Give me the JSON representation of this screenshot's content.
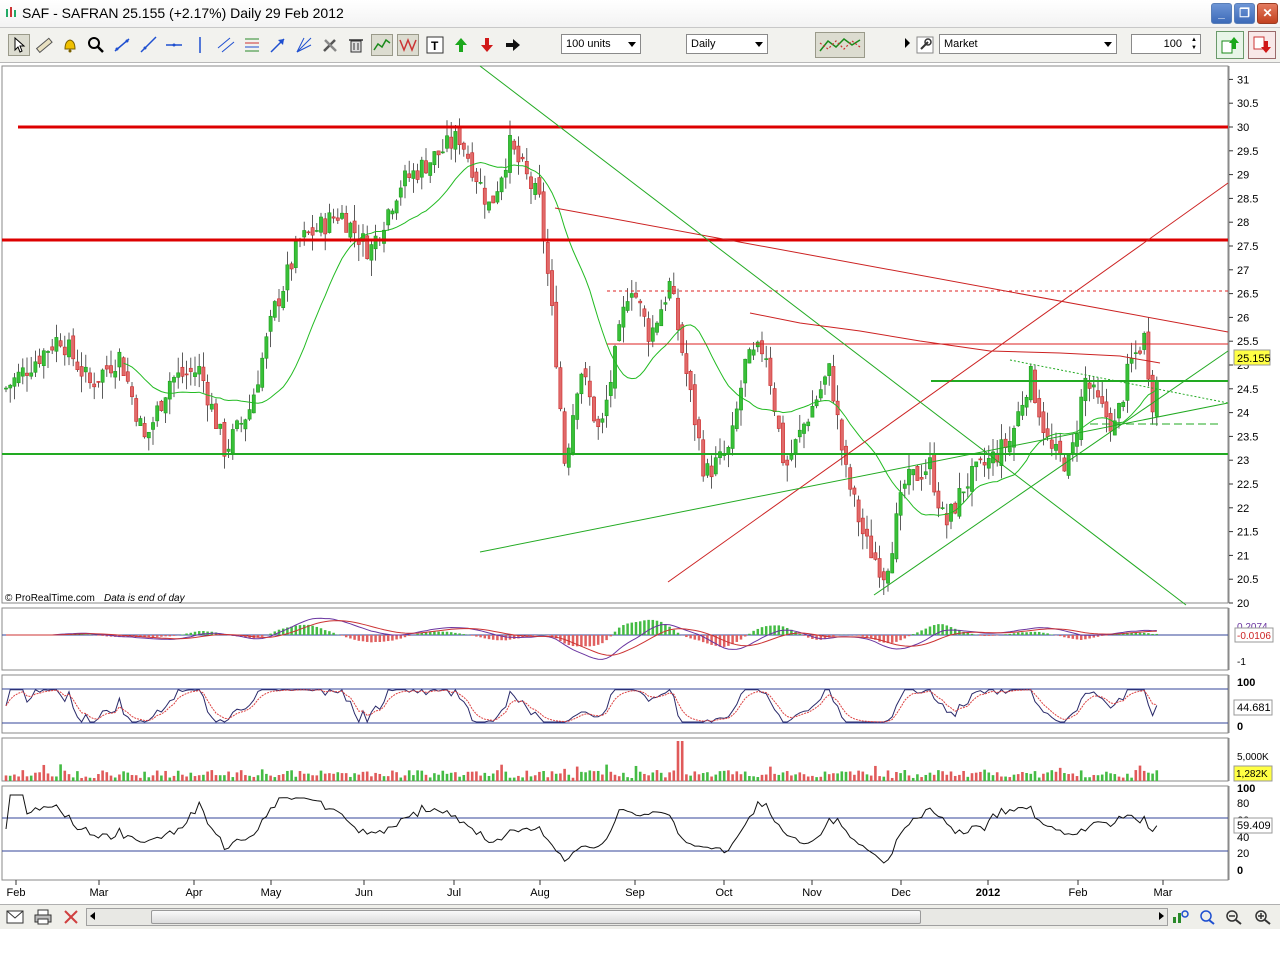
{
  "window": {
    "title": "SAF - SAFRAN    25.155 (+2.17%)    Daily  29 Feb 2012",
    "minimize_label": "_",
    "maximize_label": "❐",
    "close_label": "✕"
  },
  "toolbar": {
    "units_value": "100 units",
    "period_value": "Daily",
    "order_type_value": "Market",
    "quantity_value": "100"
  },
  "price_panel": {
    "watermark": "© ProRealTime.com",
    "data_note": "Data is end of day",
    "last_price": "25.155",
    "y_ticks": [
      "31",
      "30.5",
      "30",
      "29.5",
      "29",
      "28.5",
      "28",
      "27.5",
      "27",
      "26.5",
      "26",
      "25.5",
      "25",
      "24.5",
      "24",
      "23.5",
      "23",
      "22.5",
      "22",
      "21.5",
      "21",
      "20.5",
      "20"
    ]
  },
  "macd_panel": {
    "value_1": "0.2074",
    "value_2": "-0.0106",
    "tick": "-1"
  },
  "stoch_panel": {
    "tick_top": "100",
    "tick_bottom": "0",
    "value": "44.681"
  },
  "volume_panel": {
    "tick": "5,000K",
    "value": "1,282K"
  },
  "rsi_panel": {
    "ticks": [
      "100",
      "80",
      "60",
      "40",
      "20",
      "0"
    ],
    "value": "59.409"
  },
  "x_axis": {
    "labels": [
      "Feb",
      "Mar",
      "Apr",
      "May",
      "Jun",
      "Jul",
      "Aug",
      "Sep",
      "Oct",
      "Nov",
      "Dec",
      "2012",
      "Feb",
      "Mar"
    ]
  },
  "colors": {
    "up_candle": "#1e9e1e",
    "down_candle": "#cc2a2a",
    "resistance": "#dd0000",
    "support": "#22aa22",
    "price_badge": "#ffff44"
  },
  "icons": [
    "pointer-icon",
    "ruler-icon",
    "alert-bell-icon",
    "zoom-icon",
    "line-icon",
    "ray-icon",
    "horizontal-line-icon",
    "vertical-line-icon",
    "channel-icon",
    "fibonacci-icon",
    "arrow-icon",
    "gann-icon",
    "tools-icon",
    "trash-icon",
    "indicator-icon",
    "pattern-icon",
    "text-icon",
    "up-arrow-icon",
    "down-arrow-icon",
    "right-arrow-icon",
    "orders-icon",
    "wrench-icon",
    "buy-icon",
    "sell-icon"
  ]
}
